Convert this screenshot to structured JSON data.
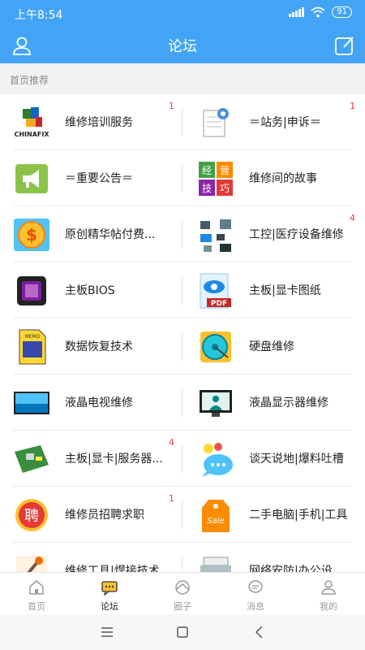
{
  "status_bar": {
    "time": "上午8:54",
    "battery": "91"
  },
  "header": {
    "title": "论坛"
  },
  "section": {
    "title": "首页推荐"
  },
  "forums": [
    {
      "left": {
        "icon": "chinafix-logo-icon",
        "label": "维修培训服务",
        "badge": "1"
      },
      "right": {
        "icon": "notepad-icon",
        "label": "＝站务|申诉＝",
        "badge": "1"
      }
    },
    {
      "left": {
        "icon": "megaphone-icon",
        "label": "＝重要公告＝",
        "badge": ""
      },
      "right": {
        "icon": "story-tiles-icon",
        "label": "维修间的故事",
        "badge": ""
      }
    },
    {
      "left": {
        "icon": "dollar-icon",
        "label": "原创精华帖付费...",
        "badge": ""
      },
      "right": {
        "icon": "equipment-icon",
        "label": "工控|医疗设备维修",
        "badge": "4"
      }
    },
    {
      "left": {
        "icon": "chip-icon",
        "label": "主板BIOS",
        "badge": ""
      },
      "right": {
        "icon": "pdf-icon",
        "label": "主板|显卡图纸",
        "badge": ""
      }
    },
    {
      "left": {
        "icon": "sd-card-icon",
        "label": "数据恢复技术",
        "badge": ""
      },
      "right": {
        "icon": "hard-disk-icon",
        "label": "硬盘维修",
        "badge": ""
      }
    },
    {
      "left": {
        "icon": "tv-screen-icon",
        "label": "液晶电视维修",
        "badge": ""
      },
      "right": {
        "icon": "monitor-icon",
        "label": "液晶显示器维修",
        "badge": ""
      }
    },
    {
      "left": {
        "icon": "motherboard-icon",
        "label": "主板|显卡|服务器...",
        "badge": "4"
      },
      "right": {
        "icon": "chat-bubble-icon",
        "label": "谈天说地|爆料吐槽",
        "badge": ""
      }
    },
    {
      "left": {
        "icon": "hire-seal-icon",
        "label": "维修员招聘求职",
        "badge": "1"
      },
      "right": {
        "icon": "sale-tag-icon",
        "label": "二手电脑|手机|工具",
        "badge": ""
      }
    },
    {
      "left": {
        "icon": "tools-icon",
        "label": "维修工具|焊接技术",
        "badge": ""
      },
      "right": {
        "icon": "printer-icon",
        "label": "网络安防|办公设",
        "badge": ""
      }
    }
  ],
  "nav": [
    {
      "label": "首页",
      "icon": "home-icon"
    },
    {
      "label": "论坛",
      "icon": "forum-icon",
      "active": true
    },
    {
      "label": "圈子",
      "icon": "circle-icon"
    },
    {
      "label": "消息",
      "icon": "message-icon"
    },
    {
      "label": "我的",
      "icon": "profile-icon"
    }
  ],
  "colors": {
    "primary": "#43a4f5",
    "badge": "#e0453b",
    "section_bg": "#f2f2f2"
  }
}
